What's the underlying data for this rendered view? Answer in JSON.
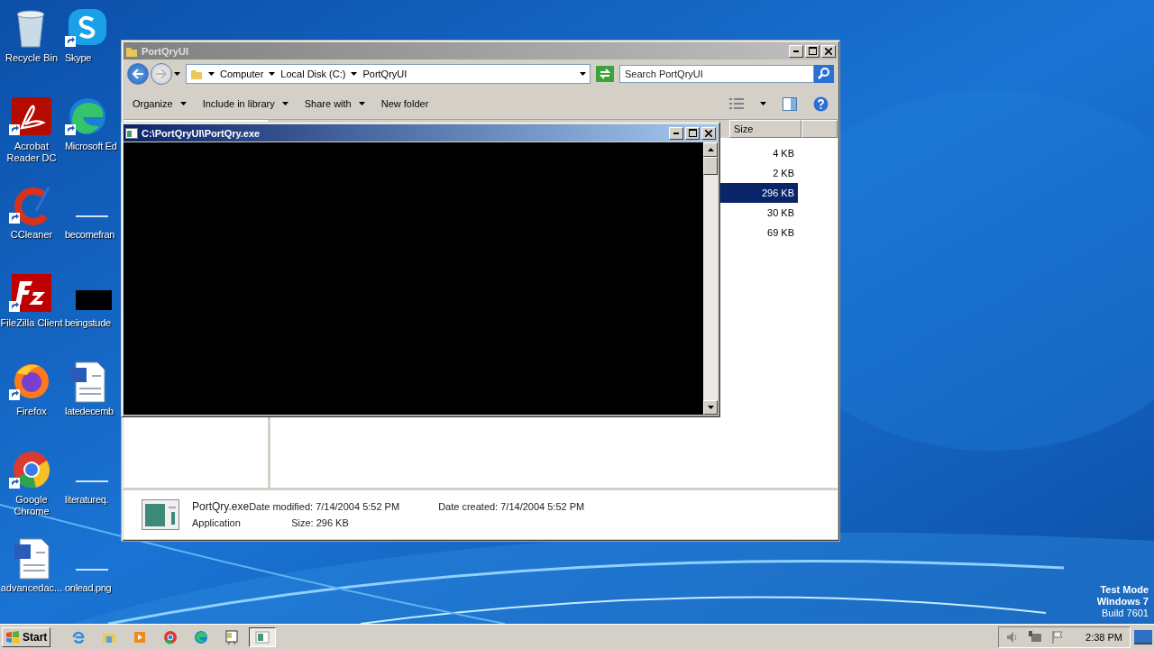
{
  "desktop_icons": [
    {
      "label": "Recycle Bin",
      "kind": "recycle"
    },
    {
      "label": "Acrobat Reader DC",
      "kind": "acrobat"
    },
    {
      "label": "CCleaner",
      "kind": "ccleaner"
    },
    {
      "label": "FileZilla Client",
      "kind": "filezilla"
    },
    {
      "label": "Firefox",
      "kind": "firefox"
    },
    {
      "label": "Google Chrome",
      "kind": "chrome"
    },
    {
      "label": "advancedac...",
      "kind": "word"
    },
    {
      "label": "Skype",
      "kind": "skype"
    },
    {
      "label": "Microsoft Ed",
      "kind": "edge"
    },
    {
      "label": "becomefran",
      "kind": "thumb"
    },
    {
      "label": "beingstude",
      "kind": "dark"
    },
    {
      "label": "latedecemb",
      "kind": "word"
    },
    {
      "label": "literatureq.",
      "kind": "thumb"
    },
    {
      "label": "onlead.png",
      "kind": "thumb"
    }
  ],
  "explorer": {
    "title": "PortQryUI",
    "breadcrumb": [
      "Computer",
      "Local Disk (C:)",
      "PortQryUI"
    ],
    "search": {
      "placeholder": "Search PortQryUI"
    },
    "toolbar": [
      {
        "label": "Organize",
        "dropdown": true
      },
      {
        "label": "Include in library",
        "dropdown": true
      },
      {
        "label": "Share with",
        "dropdown": true
      },
      {
        "label": "New folder",
        "dropdown": false
      }
    ],
    "columns": [
      "Size"
    ],
    "rows": [
      {
        "size": "4 KB",
        "selected": false
      },
      {
        "size": "2 KB",
        "selected": false
      },
      {
        "size": "296 KB",
        "selected": true
      },
      {
        "size": "30 KB",
        "selected": false
      },
      {
        "size": "69 KB",
        "selected": false
      }
    ],
    "details": {
      "name": "PortQry.exe",
      "type": "Application",
      "fields": [
        {
          "label": "Date modified:",
          "value": "7/14/2004 5:52 PM"
        },
        {
          "label": "Date created:",
          "value": "7/14/2004 5:52 PM"
        },
        {
          "label": "Size:",
          "value": "296 KB"
        }
      ]
    }
  },
  "console": {
    "title": "C:\\PortQryUI\\PortQry.exe"
  },
  "watermark_os": [
    "Test Mode",
    "Windows 7",
    "Build 7601"
  ],
  "taskbar": {
    "start": "Start",
    "items": [
      {
        "kind": "ie",
        "active": false
      },
      {
        "kind": "folder",
        "active": false
      },
      {
        "kind": "media",
        "active": false
      },
      {
        "kind": "chrome",
        "active": false
      },
      {
        "kind": "edge",
        "active": false
      },
      {
        "kind": "app",
        "active": false
      },
      {
        "kind": "console",
        "active": true
      }
    ],
    "clock": "2:38 PM"
  }
}
